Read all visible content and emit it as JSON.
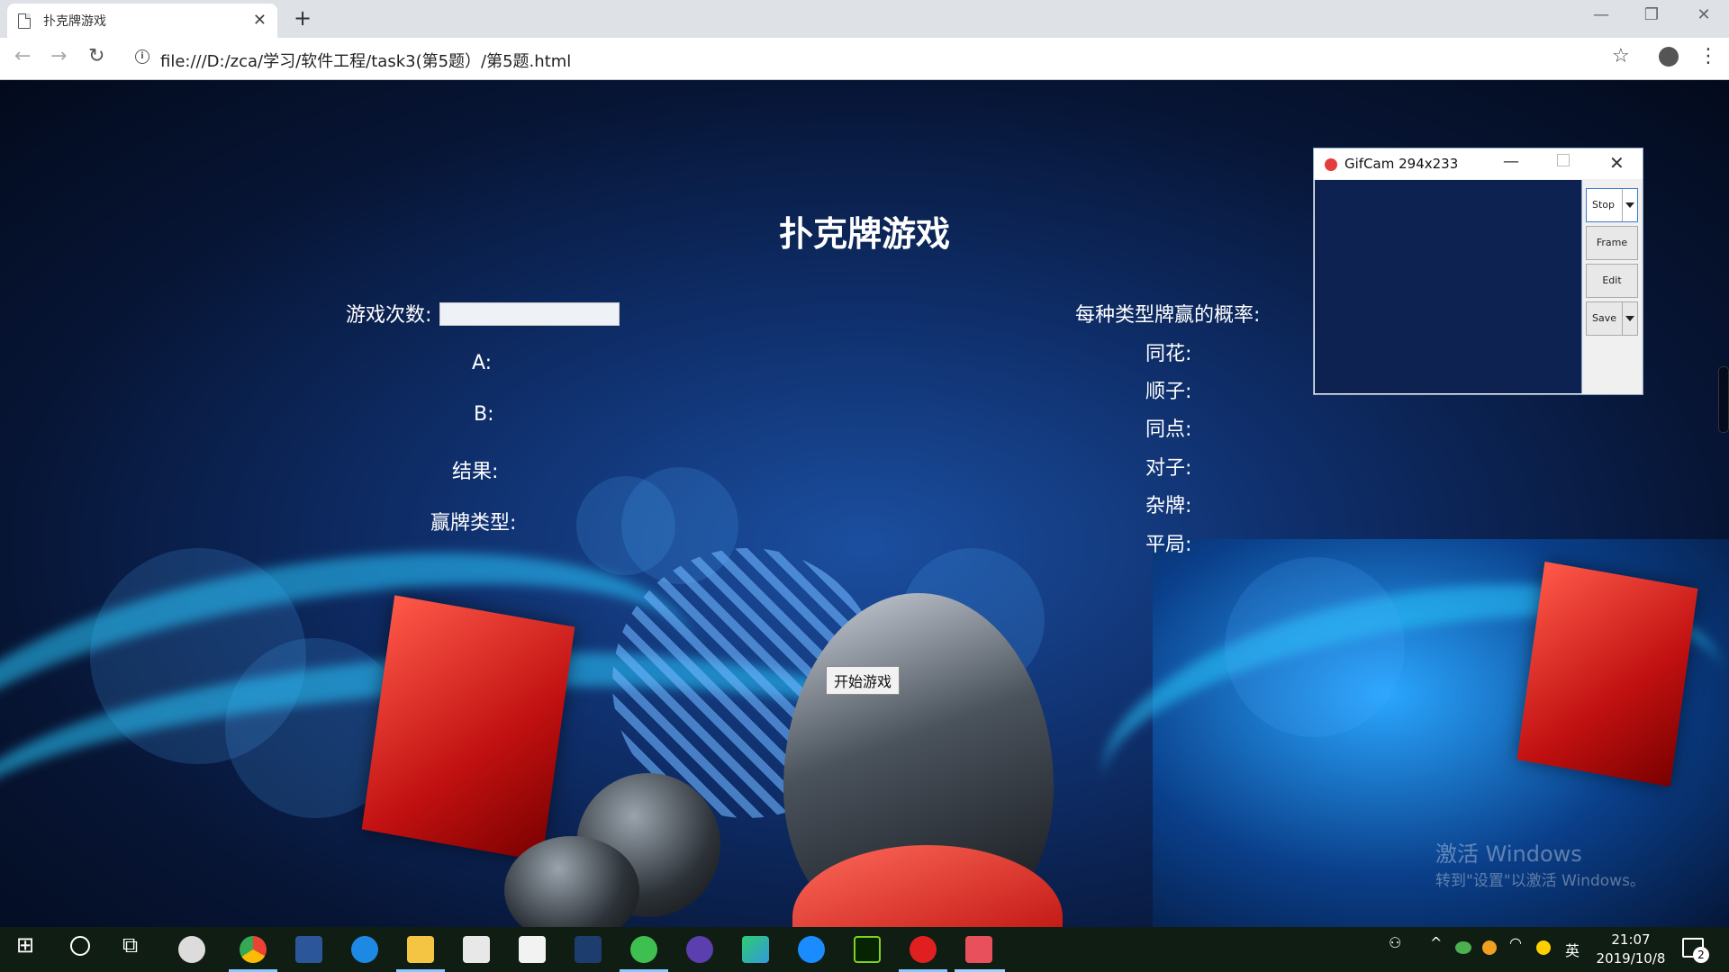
{
  "browser": {
    "tab_title": "扑克牌游戏",
    "tab_close": "✕",
    "new_tab": "+",
    "window_controls": {
      "minimize": "—",
      "restore": "❐",
      "close": "✕"
    },
    "back": "←",
    "forward": "→",
    "reload": "↻",
    "url": "file:///D:/zca/学习/软件工程/task3(第5题）/第5题.html",
    "bookmark": "☆",
    "menu": "⋮"
  },
  "page": {
    "title": "扑克牌游戏",
    "games_label": "游戏次数:",
    "games_value": "",
    "player_a": "A:",
    "player_b": "B:",
    "result": "结果:",
    "win_type": "赢牌类型:",
    "prob_header": "每种类型牌赢的概率:",
    "prob_types": [
      "同花:",
      "顺子:",
      "同点:",
      "对子:",
      "杂牌:",
      "平局:"
    ],
    "start_button": "开始游戏"
  },
  "gifcam": {
    "title": "GifCam 294x233",
    "minimize": "—",
    "close": "✕",
    "buttons": {
      "stop": "Stop",
      "frame": "Frame",
      "edit": "Edit",
      "save": "Save"
    }
  },
  "watermark": {
    "line1": "激活 Windows",
    "line2": "转到\"设置\"以激活 Windows。"
  },
  "taskbar": {
    "apps": [
      "start",
      "cortana",
      "task-view",
      "app-s",
      "chrome",
      "word",
      "edge",
      "file-explorer",
      "mail",
      "store",
      "mysql",
      "app-e",
      "infinity",
      "app-play",
      "kugou",
      "dreamweaver",
      "netease-music",
      "gifcam"
    ],
    "tray": {
      "ime": "英"
    },
    "time": "21:07",
    "date": "2019/10/8",
    "notification_count": "2"
  },
  "colors": {
    "page_text": "#ffffff",
    "taskbar": "#0f1d12",
    "tab_bar": "#dee1e6"
  }
}
